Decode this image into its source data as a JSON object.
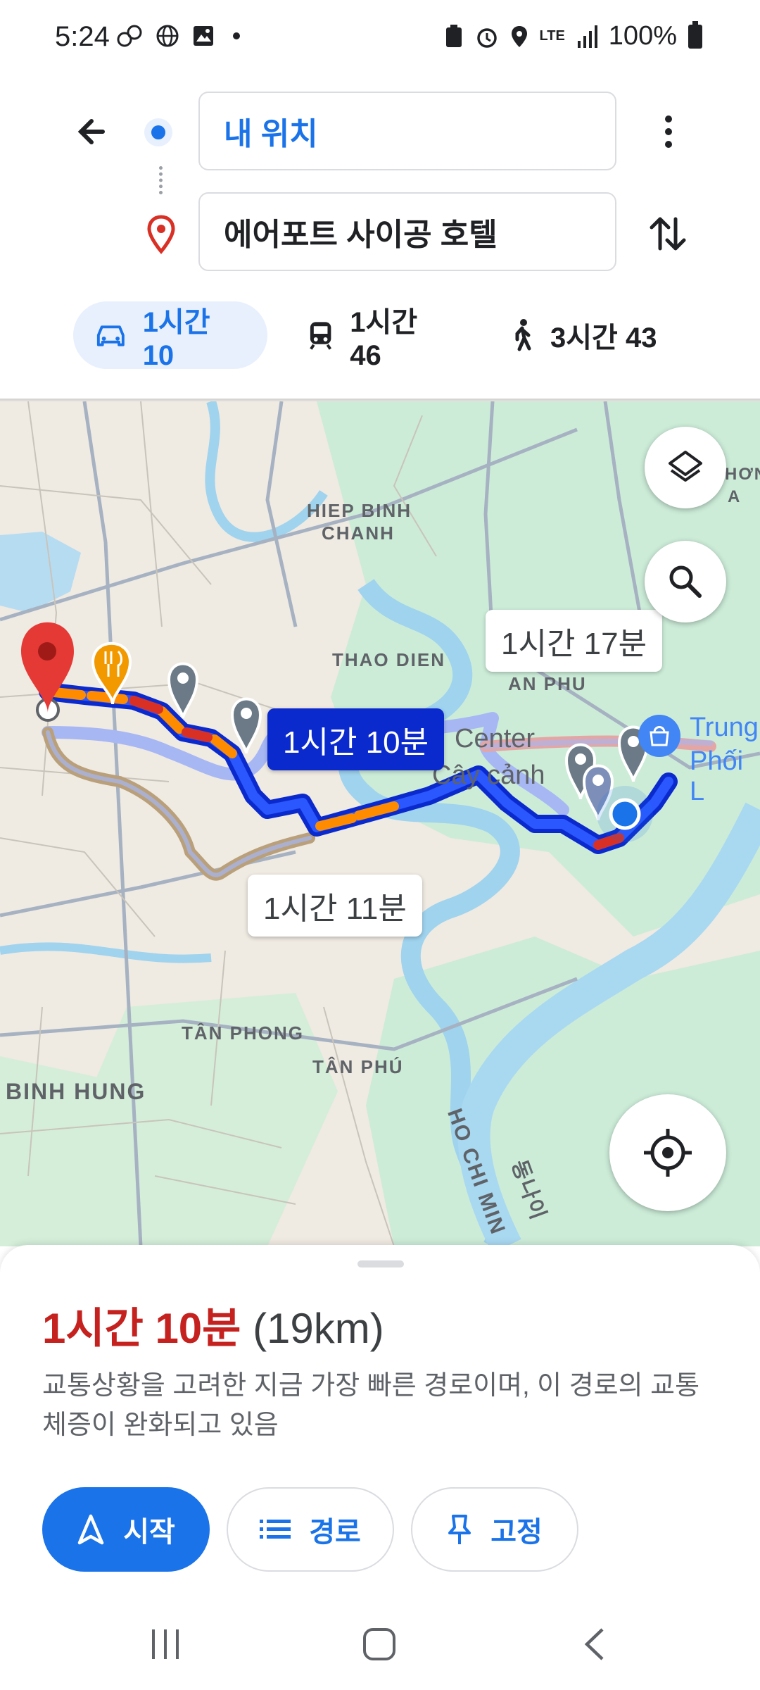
{
  "status_bar": {
    "time": "5:24",
    "network": "LTE",
    "battery": "100%"
  },
  "header": {
    "origin": "내 위치",
    "destination": "에어포트 사이공 호텔"
  },
  "modes": [
    {
      "label": "1시간 10",
      "icon": "car-icon",
      "selected": true
    },
    {
      "label": "1시간 46",
      "icon": "train-icon",
      "selected": false
    },
    {
      "label": "3시간 43",
      "icon": "walk-icon",
      "selected": false
    }
  ],
  "map": {
    "labels": {
      "hiep_binh_1": "HIEP BINH",
      "hiep_binh_2": "CHANH",
      "thao_dien": "THAO DIEN",
      "an_phu": "AN PHU",
      "center": "Center",
      "cay_canh": "Cây cảnh",
      "tan_phong": "TÂN PHONG",
      "tan_phu": "TÂN PHÚ",
      "binh_hung": "BINH HUNG",
      "ho_chi_minh": "HO CHI MIN",
      "dong_nai": "동나이",
      "trung_1": "Trung",
      "trung_2": "Phối L",
      "hon_a_1": "HƠN",
      "hon_a_2": "A"
    },
    "route_labels": {
      "main": "1시간 10분",
      "alt1": "1시간 17분",
      "alt2": "1시간 11분"
    }
  },
  "sheet": {
    "duration": "1시간 10분",
    "distance": "(19km)",
    "description": "교통상황을 고려한 지금 가장 빠른 경로이며, 이 경로의 교통체증이 완화되고 있음",
    "buttons": {
      "start": "시작",
      "steps": "경로",
      "pin": "고정"
    }
  },
  "colors": {
    "accent": "#1a73e8",
    "duration": "#c5221f",
    "route_selected": "#0b2acd"
  }
}
